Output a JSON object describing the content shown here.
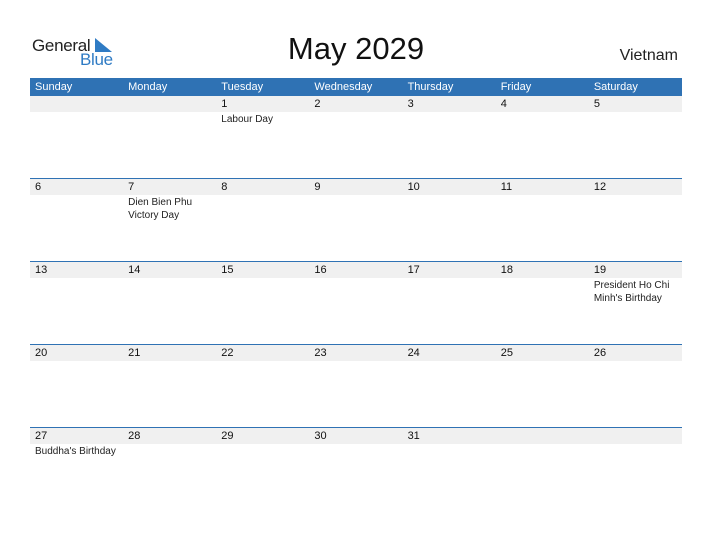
{
  "logo": {
    "word1": "General",
    "word2": "Blue"
  },
  "title": "May 2029",
  "country": "Vietnam",
  "colors": {
    "header_bg": "#2f72b4",
    "accent": "#2f7bc4",
    "row_bg": "#f0f0f0"
  },
  "weekdays": [
    "Sunday",
    "Monday",
    "Tuesday",
    "Wednesday",
    "Thursday",
    "Friday",
    "Saturday"
  ],
  "weeks": [
    {
      "days": [
        "",
        "",
        "1",
        "2",
        "3",
        "4",
        "5"
      ],
      "events": [
        "",
        "",
        "Labour Day",
        "",
        "",
        "",
        ""
      ]
    },
    {
      "days": [
        "6",
        "7",
        "8",
        "9",
        "10",
        "11",
        "12"
      ],
      "events": [
        "",
        "Dien Bien Phu Victory Day",
        "",
        "",
        "",
        "",
        ""
      ]
    },
    {
      "days": [
        "13",
        "14",
        "15",
        "16",
        "17",
        "18",
        "19"
      ],
      "events": [
        "",
        "",
        "",
        "",
        "",
        "",
        "President Ho Chi Minh's Birthday"
      ]
    },
    {
      "days": [
        "20",
        "21",
        "22",
        "23",
        "24",
        "25",
        "26"
      ],
      "events": [
        "",
        "",
        "",
        "",
        "",
        "",
        ""
      ]
    },
    {
      "days": [
        "27",
        "28",
        "29",
        "30",
        "31",
        "",
        ""
      ],
      "events": [
        "Buddha's Birthday",
        "",
        "",
        "",
        "",
        "",
        ""
      ]
    }
  ]
}
